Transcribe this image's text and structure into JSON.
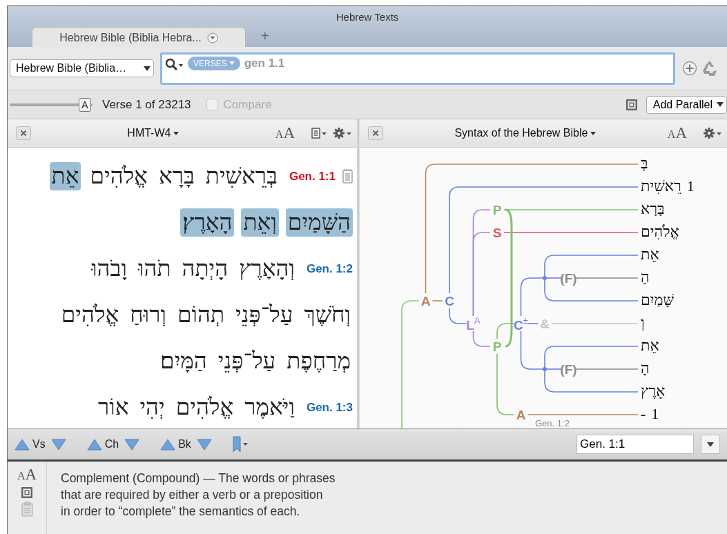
{
  "window": {
    "title": "Hebrew Texts"
  },
  "tabs": [
    {
      "label": "Hebrew Bible (Biblia Hebra...",
      "selected": true
    }
  ],
  "new_tab": "+",
  "toolbar": {
    "resource": "Hebrew Bible (Biblia…",
    "search": {
      "scope": "VERSES",
      "value": "gen 1.1"
    }
  },
  "reading_bar": {
    "font_slider": {
      "thumb": "A",
      "level": 0.98
    },
    "position": "Verse 1 of 23213",
    "compare": {
      "label": "Compare",
      "checked": false,
      "disabled": true
    },
    "add_parallel": "Add Parallel"
  },
  "text_pane": {
    "title": "HMT-W4",
    "font_button": {
      "small": "A",
      "large": "A"
    },
    "verses": [
      {
        "ref": "Gen. 1:1",
        "current": true,
        "has_note": true,
        "lines": [
          [
            {
              "text": "בְּרֵאשִׁית",
              "highlighted": false
            },
            {
              "text": "בָּרָא",
              "highlighted": false
            },
            {
              "text": "אֱלֹהִים",
              "highlighted": false
            },
            {
              "text": "אֵת",
              "highlighted": true
            }
          ],
          [
            {
              "text": "הַשָּׁמַיִם",
              "highlighted": true
            },
            {
              "text": "וְאֵת",
              "highlighted": true
            },
            {
              "text": "הָאָרֶץ׃",
              "highlighted": true
            }
          ]
        ]
      },
      {
        "ref": "Gen. 1:2",
        "current": false,
        "has_note": false,
        "lines": [
          [
            {
              "text": "וְהָאָרֶץ",
              "highlighted": false
            },
            {
              "text": "הָיְתָה",
              "highlighted": false
            },
            {
              "text": "תֹהוּ",
              "highlighted": false
            },
            {
              "text": "וָבֹהוּ",
              "highlighted": false
            }
          ],
          [
            {
              "text": "וְחֹשֶׁךְ",
              "highlighted": false
            },
            {
              "text": "עַל־פְּנֵי",
              "highlighted": false
            },
            {
              "text": "תְהוֹם",
              "highlighted": false
            },
            {
              "text": "וְרוּחַ",
              "highlighted": false
            },
            {
              "text": "אֱלֹהִים",
              "highlighted": false
            }
          ],
          [
            {
              "text": "מְרַחֶפֶת",
              "highlighted": false
            },
            {
              "text": "עַל־פְּנֵי",
              "highlighted": false
            },
            {
              "text": "הַמָּיִם׃",
              "highlighted": false
            }
          ]
        ]
      },
      {
        "ref": "Gen. 1:3",
        "current": false,
        "has_note": false,
        "lines": [
          [
            {
              "text": "וַיֹּאמֶר",
              "highlighted": false
            },
            {
              "text": "אֱלֹהִים",
              "highlighted": false
            },
            {
              "text": "יְהִי",
              "highlighted": false
            },
            {
              "text": "אוֹר",
              "highlighted": false
            }
          ]
        ]
      }
    ]
  },
  "syntax_pane": {
    "title": "Syntax of the Hebrew Bible",
    "font_button": {
      "small": "A",
      "large": "A"
    },
    "footer_ref": "Gen. 1:2",
    "tree": {
      "kind": "clause",
      "color": "#8cc47a",
      "children": [
        {
          "kind": "node",
          "label": "A",
          "color": "#b5875a",
          "children": [
            {
              "kind": "leaf",
              "word": "בְּ"
            },
            {
              "kind": "node",
              "label": "C",
              "color": "#6a7fe0",
              "children": [
                {
                  "kind": "leaf",
                  "word": "רֵאשִׁית",
                  "num": "1"
                },
                {
                  "kind": "node",
                  "label": "L$^{A}$",
                  "color": "#a483d8",
                  "bracket": true,
                  "children": [
                    {
                      "kind": "node",
                      "label": "P",
                      "color": "#7fbf6c",
                      "children": [
                        {
                          "kind": "leaf",
                          "word": "בָּרָא"
                        }
                      ]
                    },
                    {
                      "kind": "node",
                      "label": "S",
                      "color": "#df5560",
                      "children": [
                        {
                          "kind": "leaf",
                          "word": "אֱלֹהִים"
                        }
                      ]
                    },
                    {
                      "kind": "node",
                      "label": "P",
                      "color": "#7fbf6c",
                      "children": [
                        {
                          "kind": "node",
                          "label": "C$^{±}$",
                          "color": "#6a7fe0",
                          "children": [
                            {
                              "kind": "junction",
                              "color": "#6a7fe0",
                              "children": [
                                {
                                  "kind": "leaf",
                                  "word": "אֵת"
                                },
                                {
                                  "kind": "node",
                                  "label": "(F)",
                                  "color": "#8a8a8a",
                                  "children": [
                                    {
                                      "kind": "leaf",
                                      "word": "הַ"
                                    }
                                  ]
                                },
                                {
                                  "kind": "leaf",
                                  "word": "שָּׁמַיִם"
                                }
                              ]
                            },
                            {
                              "kind": "node",
                              "label": "&",
                              "color": "#c4c4c4",
                              "children": [
                                {
                                  "kind": "leaf",
                                  "word": "וְ"
                                }
                              ]
                            },
                            {
                              "kind": "junction",
                              "color": "#6a7fe0",
                              "children": [
                                {
                                  "kind": "leaf",
                                  "word": "אֵת"
                                },
                                {
                                  "kind": "node",
                                  "label": "(F)",
                                  "color": "#8a8a8a",
                                  "children": [
                                    {
                                      "kind": "leaf",
                                      "word": "הָ"
                                    }
                                  ]
                                },
                                {
                                  "kind": "leaf",
                                  "word": "אָרֶץ"
                                }
                              ]
                            }
                          ]
                        },
                        {
                          "kind": "node",
                          "label": "A",
                          "color": "#b5875a",
                          "children": [
                            {
                              "kind": "leaf",
                              "word": "-",
                              "num": "1"
                            }
                          ]
                        }
                      ]
                    }
                  ]
                }
              ]
            }
          ]
        }
      ]
    }
  },
  "nav": {
    "verse_stepper": {
      "label": "Vs"
    },
    "chapter_stepper": {
      "label": "Ch"
    },
    "book_stepper": {
      "label": "Bk"
    },
    "reference": "Gen. 1:1"
  },
  "info": {
    "font_button": {
      "small": "A",
      "large": "A"
    },
    "lines": [
      "Complement (Compound) — The words or phrases",
      "that are required by either a verb or a preposition",
      "in order to “complete” the semantics of each."
    ]
  }
}
